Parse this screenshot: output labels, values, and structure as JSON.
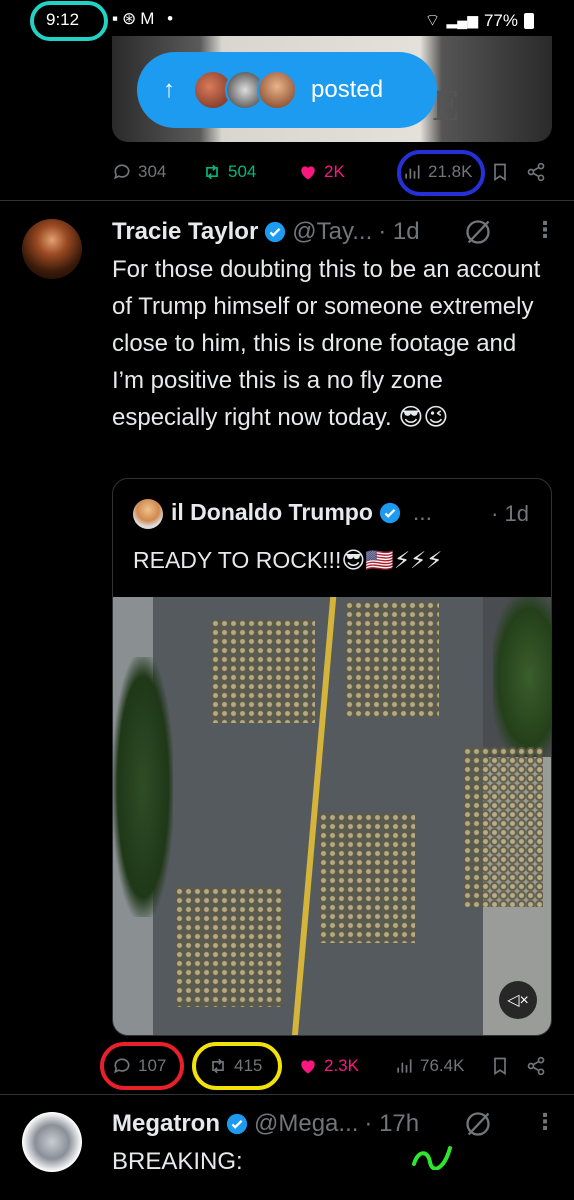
{
  "status_bar": {
    "time": "9:12",
    "battery": "77%"
  },
  "top_post": {
    "posted_label": "posted",
    "stats": {
      "replies": "304",
      "reposts": "504",
      "likes": "2K",
      "views": "21.8K"
    }
  },
  "tweet": {
    "name": "Tracie Taylor",
    "handle": "@Tay...",
    "time": "· 1d",
    "text": "For those doubting this to be an account of Trump himself or someone extremely close to him, this is drone footage and I’m positive this is a no fly zone especially right now today. 😎😉",
    "quote": {
      "name": "il Donaldo Trumpo",
      "dots": "...",
      "time": "· 1d",
      "text": "READY TO ROCK!!!😎🇺🇸⚡⚡⚡"
    },
    "stats": {
      "replies": "107",
      "reposts": "415",
      "likes": "2.3K",
      "views": "76.4K"
    }
  },
  "next_tweet": {
    "name": "Megatron",
    "handle": "@Mega...",
    "time": "· 17h",
    "text": "BREAKING:"
  },
  "colors": {
    "accent": "#1d9bf0",
    "repost": "#00ba7c",
    "like": "#f91880",
    "muted": "#71767b"
  }
}
